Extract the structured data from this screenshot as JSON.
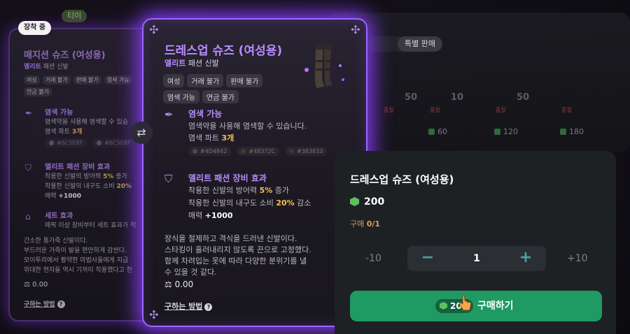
{
  "shop_tab_label": "티이",
  "background_shop": {
    "tabs": [
      "특별 판매"
    ],
    "items": [
      {
        "count": "50",
        "tag": "품절",
        "price": ""
      },
      {
        "count": "10",
        "tag": "품절",
        "price": "60"
      },
      {
        "count": "50",
        "tag": "품절",
        "price": "120"
      },
      {
        "count": "",
        "tag": "품절",
        "price": "180"
      }
    ]
  },
  "equipped_card": {
    "badge": "장착 중",
    "name": "매지션 슈즈 (여성용)",
    "grade": "엘리트",
    "type": "패션 신발",
    "tags": [
      "여성",
      "거래 불가",
      "판매 불가",
      "염색 가능",
      "연금 불가"
    ],
    "dye": {
      "title": "염색 가능",
      "line1": "염색약을 사용해 염색할 수 있습",
      "line2_prefix": "염색 파트 ",
      "line2_value": "3개",
      "swatches": [
        "#6C5E8F",
        "#6C5E8F"
      ]
    },
    "elite": {
      "title": "엘리트 패션 장비 효과",
      "line1_prefix": "착용한 신발의 방어력 ",
      "line1_value": "5%",
      "line1_suffix": " 증가",
      "line2_prefix": "착용한 신발의 내구도 소비 ",
      "line2_value": "20%",
      "line3_prefix": "매력 ",
      "line3_value": "+1000"
    },
    "set": {
      "title": "세트 효과",
      "line1": "에픽 이상 장비부터 세트 효과가 적"
    },
    "description": [
      "간소한 통가죽 신발이다.",
      "부드러운 가죽이 발을 편안하게 감싼다.",
      "모이투리에서 활약한 마법사들에게 지급",
      "위대한 현자들 역시 기꺼이 착용했다고 한"
    ],
    "weight": "0.00",
    "how_to_get": "구하는 방법"
  },
  "main_card": {
    "name": "드레스업 슈즈 (여성용)",
    "grade": "엘리트",
    "type": "패션 신발",
    "tags": [
      "여성",
      "거래 불가",
      "판매 불가",
      "염색 가능",
      "연금 불가"
    ],
    "dye": {
      "title": "염색 가능",
      "line1": "염색약을 사용해 염색할 수 있습니다.",
      "line2_prefix": "염색 파트 ",
      "line2_value": "3개",
      "swatches": [
        {
          "label": "#4D4842",
          "color": "#4D4842"
        },
        {
          "label": "#48372C",
          "color": "#48372C"
        },
        {
          "label": "#383833",
          "color": "#383833"
        }
      ]
    },
    "elite": {
      "title": "엘리트 패션 장비 효과",
      "line1_prefix": "착용한 신발의 방어력 ",
      "line1_value": "5%",
      "line1_suffix": " 증가",
      "line2_prefix": "착용한 신발의 내구도 소비 ",
      "line2_value": "20%",
      "line2_suffix": " 감소",
      "line3_prefix": "매력 ",
      "line3_value": "+1000"
    },
    "description": [
      "장식을 절제하고 격식을 드러낸 신발이다.",
      "스타킹이 흘러내리지 않도록 끈으로 고정했다.",
      "함께 차려입는 옷에 따라 다양한 분위기를 낼",
      "수 있을 것 같다."
    ],
    "weight": "0.00",
    "how_to_get": "구하는 방법"
  },
  "purchase": {
    "title": "드레스업 슈즈 (여성용)",
    "price": "200",
    "limit_label": "구매",
    "limit_value": "0/1",
    "qty_min": "-10",
    "qty_max": "+10",
    "quantity": "1",
    "minus_label": "−",
    "plus_label": "+",
    "buy_price": "200",
    "buy_label": "구매하기"
  },
  "colors": {
    "accent": "#9B66FF",
    "buy": "#1F9A63",
    "currency": "#5FBF5A"
  }
}
